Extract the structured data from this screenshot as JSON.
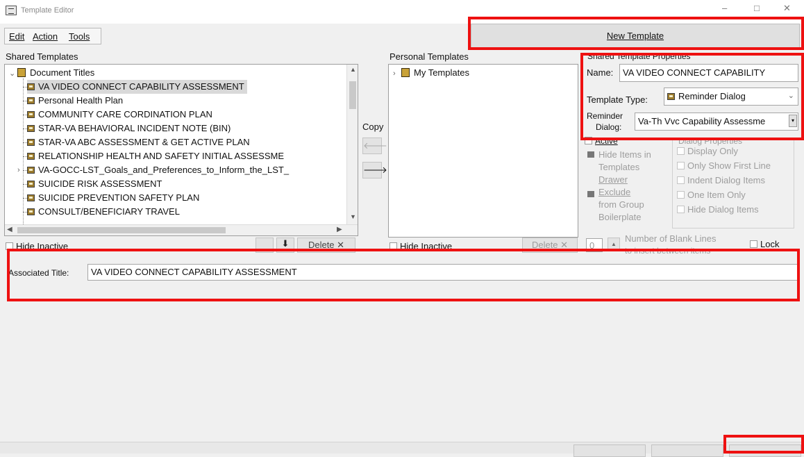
{
  "window": {
    "title": "Template Editor",
    "minimize": "–",
    "maximize": "□",
    "close": "✕"
  },
  "menu": {
    "edit": "Edit",
    "action": "Action",
    "tools": "Tools"
  },
  "toolbar": {
    "new_template": "New Template"
  },
  "shared": {
    "heading": "Shared Templates",
    "root_label": "Document Titles",
    "items": [
      "VA VIDEO CONNECT CAPABILITY ASSESSMENT",
      "Personal Health Plan",
      "COMMUNITY CARE CORDINATION PLAN",
      "STAR-VA BEHAVIORAL INCIDENT NOTE (BIN)",
      "STAR-VA ABC ASSESSMENT & GET ACTIVE PLAN",
      "RELATIONSHIP HEALTH AND SAFETY INITIAL ASSESSME",
      "VA-GOCC-LST_Goals_and_Preferences_to_Inform_the_LST_",
      "SUICIDE RISK ASSESSMENT",
      "SUICIDE PREVENTION SAFETY PLAN",
      "CONSULT/BENEFICIARY TRAVEL"
    ],
    "hide_inactive": "Hide Inactive",
    "delete": "Delete"
  },
  "copy": {
    "label": "Copy"
  },
  "personal": {
    "heading": "Personal Templates",
    "root_label": "My Templates",
    "hide_inactive": "Hide Inactive",
    "delete": "Delete"
  },
  "properties": {
    "heading": "Shared Template Properties",
    "name_label": "Name:",
    "name_value": "VA VIDEO CONNECT CAPABILITY",
    "type_label": "Template Type:",
    "type_value": "Reminder Dialog",
    "reminder_label_1": "Reminder",
    "reminder_label_2": "Dialog:",
    "reminder_value": "Va-Th Vvc Capability Assessme",
    "active": "Active",
    "hide_items_1": "Hide Items in",
    "hide_items_2": "Templates",
    "hide_items_3": "Drawer",
    "exclude_1": "Exclude",
    "exclude_2": "from Group",
    "exclude_3": "Boilerplate",
    "dialog_heading": "Dialog Properties",
    "dialog_options": [
      "Display Only",
      "Only Show First Line",
      "Indent Dialog Items",
      "One Item Only",
      "Hide Dialog Items"
    ],
    "blank_lines_value": "0",
    "blank_lines_1": "Number of Blank Lines",
    "blank_lines_2": "to insert between items",
    "lock": "Lock"
  },
  "associated": {
    "label": "Associated Title:",
    "value": "VA VIDEO CONNECT CAPABILITY ASSESSMENT"
  },
  "colors": {
    "highlight_box": "#ee1111",
    "selected_row": "#d9d9d9"
  }
}
